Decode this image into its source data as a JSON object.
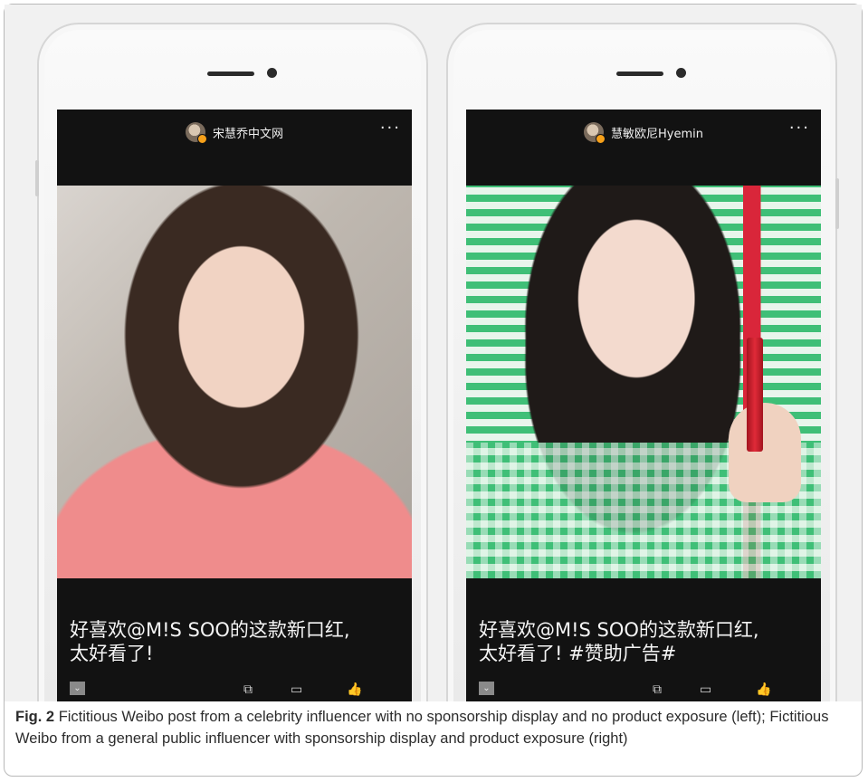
{
  "posts": [
    {
      "username": "宋慧乔中文网",
      "more": "···",
      "caption_line1": "好喜欢@M!S  SOO的这款新口红,",
      "caption_line2": "太好看了!",
      "actions": {
        "dropdown": "⌄",
        "share": "⧉",
        "comment": "▭",
        "like": "👍"
      }
    },
    {
      "username": "慧敏欧尼Hyemin",
      "more": "···",
      "caption_line1": "好喜欢@M!S  SOO的这款新口红,",
      "caption_line2": "太好看了! #赞助广告#",
      "actions": {
        "dropdown": "⌄",
        "share": "⧉",
        "comment": "▭",
        "like": "👍"
      }
    }
  ],
  "figure": {
    "label": "Fig. 2",
    "text": "Fictitious Weibo post from a celebrity influencer with no sponsorship display and no product exposure (left); Fictitious Weibo from a general public influencer with sponsorship display and product exposure (right)"
  }
}
